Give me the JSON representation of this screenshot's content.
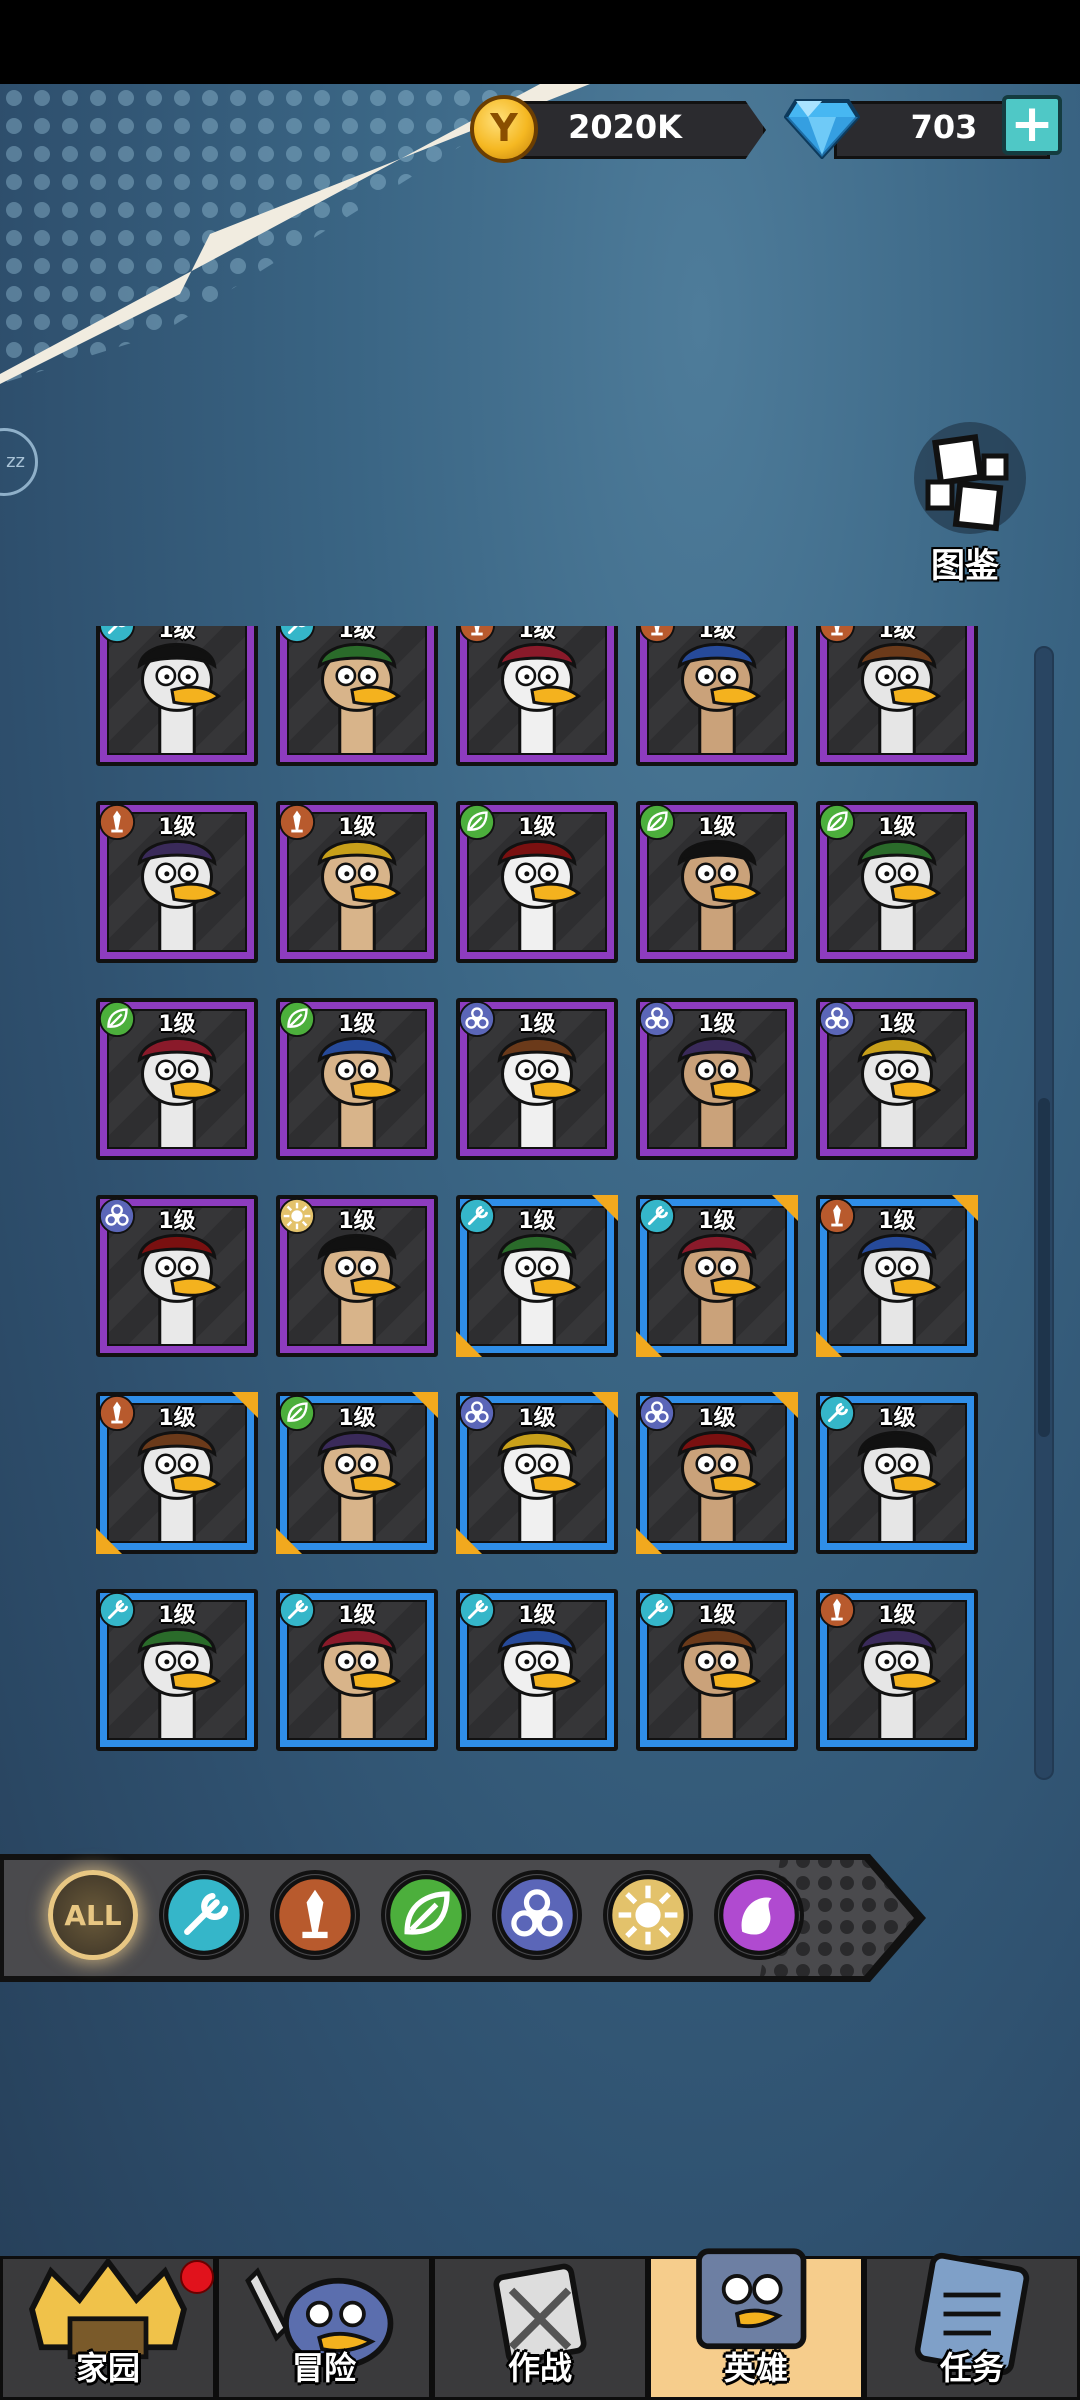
{
  "currency": {
    "coin_symbol": "Y",
    "coins": "2020K",
    "gems": "703",
    "add_label": "+"
  },
  "codex": {
    "label": "图鉴"
  },
  "sleep_label": "zz",
  "heroes": [
    {
      "level": "1级",
      "rarity": "purple",
      "element": "tech"
    },
    {
      "level": "1级",
      "rarity": "purple",
      "element": "tech"
    },
    {
      "level": "1级",
      "rarity": "purple",
      "element": "warrior"
    },
    {
      "level": "1级",
      "rarity": "purple",
      "element": "warrior"
    },
    {
      "level": "1级",
      "rarity": "purple",
      "element": "warrior"
    },
    {
      "level": "1级",
      "rarity": "purple",
      "element": "warrior"
    },
    {
      "level": "1级",
      "rarity": "purple",
      "element": "warrior"
    },
    {
      "level": "1级",
      "rarity": "purple",
      "element": "nature"
    },
    {
      "level": "1级",
      "rarity": "purple",
      "element": "nature"
    },
    {
      "level": "1级",
      "rarity": "purple",
      "element": "nature"
    },
    {
      "level": "1级",
      "rarity": "purple",
      "element": "nature"
    },
    {
      "level": "1级",
      "rarity": "purple",
      "element": "nature"
    },
    {
      "level": "1级",
      "rarity": "purple",
      "element": "biohazard"
    },
    {
      "level": "1级",
      "rarity": "purple",
      "element": "biohazard"
    },
    {
      "level": "1级",
      "rarity": "purple",
      "element": "biohazard"
    },
    {
      "level": "1级",
      "rarity": "purple",
      "element": "biohazard"
    },
    {
      "level": "1级",
      "rarity": "purple",
      "element": "holy"
    },
    {
      "level": "1级",
      "rarity": "blue",
      "element": "tech"
    },
    {
      "level": "1级",
      "rarity": "blue",
      "element": "tech"
    },
    {
      "level": "1级",
      "rarity": "blue",
      "element": "warrior"
    },
    {
      "level": "1级",
      "rarity": "blue",
      "element": "warrior"
    },
    {
      "level": "1级",
      "rarity": "blue",
      "element": "nature"
    },
    {
      "level": "1级",
      "rarity": "blue",
      "element": "biohazard"
    },
    {
      "level": "1级",
      "rarity": "blue",
      "element": "biohazard"
    },
    {
      "level": "1级",
      "rarity": "blue",
      "element": "tech"
    },
    {
      "level": "1级",
      "rarity": "blue",
      "element": "tech"
    },
    {
      "level": "1级",
      "rarity": "blue",
      "element": "tech"
    },
    {
      "level": "1级",
      "rarity": "blue",
      "element": "tech"
    },
    {
      "level": "1级",
      "rarity": "blue",
      "element": "tech"
    },
    {
      "level": "1级",
      "rarity": "blue",
      "element": "warrior"
    }
  ],
  "hero_corner_marks": [
    false,
    false,
    false,
    false,
    false,
    false,
    false,
    false,
    false,
    false,
    false,
    false,
    false,
    false,
    false,
    false,
    false,
    true,
    true,
    true,
    true,
    true,
    true,
    true,
    false,
    false,
    false,
    false,
    false,
    false
  ],
  "scroll_fraction": 0.27,
  "filters": [
    {
      "name": "all",
      "label": "ALL",
      "selected": true
    },
    {
      "name": "tech",
      "label": ""
    },
    {
      "name": "warrior",
      "label": ""
    },
    {
      "name": "nature",
      "label": ""
    },
    {
      "name": "biohazard",
      "label": ""
    },
    {
      "name": "holy",
      "label": ""
    },
    {
      "name": "arcane",
      "label": ""
    }
  ],
  "element_colors": {
    "tech": "#35b6c9",
    "warrior": "#b85a2d",
    "nature": "#4caf3c",
    "biohazard": "#5b66b8",
    "holy": "#e3c26b",
    "arcane": "#b04ad0"
  },
  "nav": [
    {
      "name": "home",
      "label": "家园",
      "badge": true
    },
    {
      "name": "adventure",
      "label": "冒险"
    },
    {
      "name": "battle",
      "label": "作战"
    },
    {
      "name": "heroes",
      "label": "英雄",
      "active": true
    },
    {
      "name": "tasks",
      "label": "任务"
    }
  ]
}
